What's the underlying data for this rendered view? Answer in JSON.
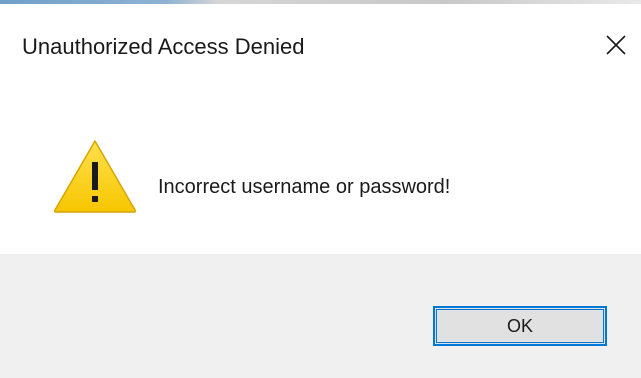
{
  "dialog": {
    "title": "Unauthorized Access Denied",
    "message": "Incorrect username or password!",
    "icon": "warning-icon",
    "ok_label": "OK",
    "close_icon": "close-icon"
  },
  "colors": {
    "accent": "#0078d7",
    "warning_fill": "#fcd116",
    "footer_bg": "#f0f0f0",
    "button_bg": "#e1e1e1"
  }
}
